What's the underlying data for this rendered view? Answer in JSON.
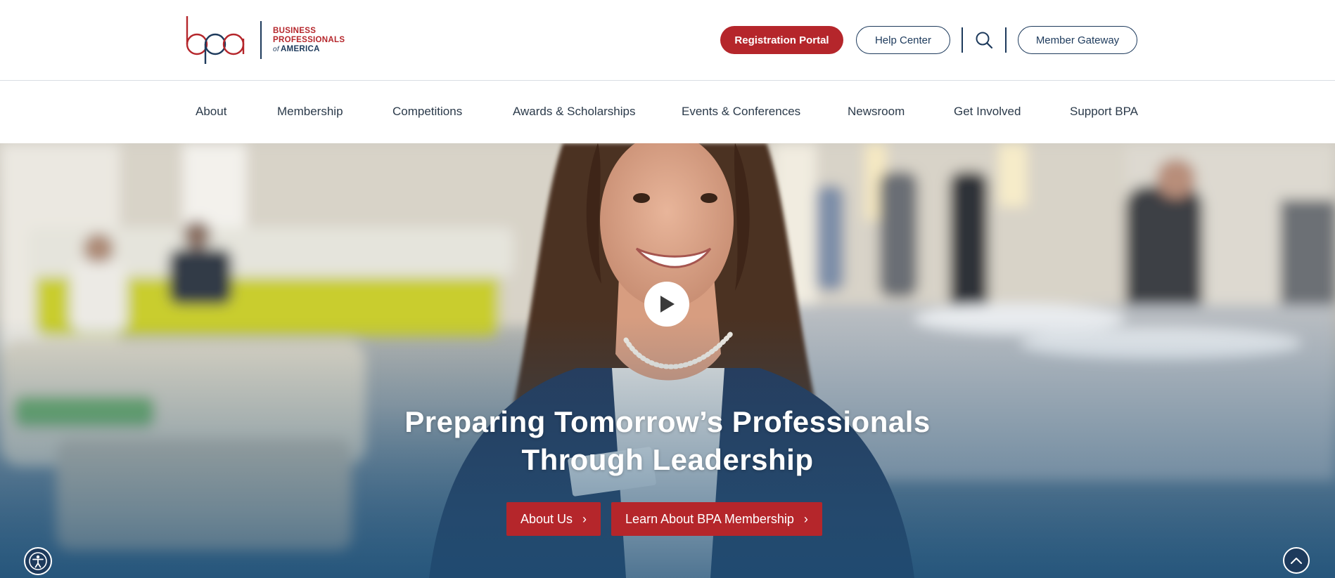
{
  "brand": {
    "logo_mark": "bpa",
    "name_line1": "BUSINESS",
    "name_line2": "PROFESSIONALS",
    "name_of": "of",
    "name_line3": "AMERICA",
    "colors": {
      "red": "#b5262b",
      "navy": "#1d3a5c"
    }
  },
  "header": {
    "registration_label": "Registration Portal",
    "help_label": "Help Center",
    "search_icon": "search-icon",
    "member_label": "Member Gateway"
  },
  "nav": {
    "items": [
      {
        "label": "About"
      },
      {
        "label": "Membership"
      },
      {
        "label": "Competitions"
      },
      {
        "label": "Awards & Scholarships"
      },
      {
        "label": "Events & Conferences"
      },
      {
        "label": "Newsroom"
      },
      {
        "label": "Get Involved"
      },
      {
        "label": "Support BPA"
      }
    ]
  },
  "hero": {
    "play_icon": "play-icon",
    "title_line1": "Preparing Tomorrow’s Professionals",
    "title_line2_prefix": "Through ",
    "title_line2_bold": "Leadership",
    "cta_primary": "About Us",
    "cta_secondary": "Learn About BPA Membership",
    "chevron": "›"
  },
  "floating": {
    "accessibility_icon": "accessibility-icon",
    "scroll_top_icon": "chevron-up-icon"
  }
}
